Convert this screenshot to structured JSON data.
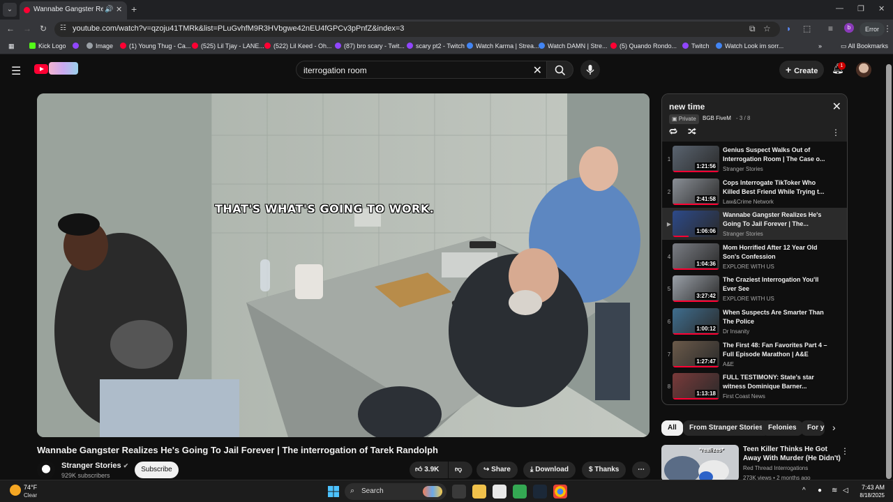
{
  "browser": {
    "tab": {
      "title": "Wannabe Gangster Realizes",
      "audio_icon": "speaker-icon",
      "close": "✕"
    },
    "new_tab": "+",
    "url": "youtube.com/watch?v=qzoju41TMRk&list=PLuGvhfM9R3HVbgwe42nEU4fGPCv3pPnfZ&index=3",
    "profile_status": "Error",
    "bookmarks": [
      {
        "label": "Kick Logo",
        "color": "#53fc18"
      },
      {
        "label": "Image",
        "color": "#9aa0a6"
      },
      {
        "label": "(1) Young Thug - Ca...",
        "color": "#ff0033"
      },
      {
        "label": "(525) Lil Tjay - LANE...",
        "color": "#ff0033"
      },
      {
        "label": "(522) Lil Keed - Oh...",
        "color": "#ff0033"
      },
      {
        "label": "(87) bro scary - Twit...",
        "color": "#9146ff"
      },
      {
        "label": "scary pt2 - Twitch",
        "color": "#9146ff"
      },
      {
        "label": "Watch Karma | Strea...",
        "color": "#4285f4"
      },
      {
        "label": "Watch DAMN | Stre...",
        "color": "#4285f4"
      },
      {
        "label": "(5) Quando Rondo...",
        "color": "#ff0033"
      },
      {
        "label": "Twitch",
        "color": "#9146ff"
      },
      {
        "label": "Watch Look im sorr...",
        "color": "#4285f4"
      }
    ],
    "all_bookmarks": "All Bookmarks"
  },
  "youtube": {
    "search_query": "iterrogation room",
    "create_label": "Create",
    "notification_count": "1"
  },
  "video": {
    "caption": "THAT'S WHAT'S GOING TO WORK.",
    "title": "Wannabe Gangster Realizes He's Going To Jail Forever | The interrogation of Tarek Randolph",
    "channel": "Stranger Stories",
    "subscribers": "929K subscribers",
    "subscribe_label": "Subscribe",
    "likes": "3.9K",
    "share_label": "Share",
    "download_label": "Download",
    "thanks_label": "Thanks"
  },
  "playlist": {
    "title": "new time",
    "privacy": "Private",
    "owner": "BGB FiveM",
    "position": "- 3 / 8",
    "items": [
      {
        "index": "1",
        "title": "Genius Suspect Walks Out of Interrogation Room | The Case o...",
        "channel": "Stranger Stories",
        "duration": "1:21:56",
        "progress": 1.0,
        "thumb": "#5a6470"
      },
      {
        "index": "2",
        "title": "Cops Interrogate TikToker Who Killed Best Friend While Trying t...",
        "channel": "Law&Crime Network",
        "duration": "2:41:58",
        "progress": 1.0,
        "thumb": "#8a8f96"
      },
      {
        "index": "▶",
        "title": "Wannabe Gangster Realizes He's Going To Jail Forever | The...",
        "channel": "Stranger Stories",
        "duration": "1:06:06",
        "progress": 0.35,
        "thumb": "#2d4a8a"
      },
      {
        "index": "4",
        "title": "Mom Horrified After 12 Year Old Son's Confession",
        "channel": "EXPLORE WITH US",
        "duration": "1:04:36",
        "progress": 1.0,
        "thumb": "#7a7d84"
      },
      {
        "index": "5",
        "title": "The Craziest Interrogation You'll Ever See",
        "channel": "EXPLORE WITH US",
        "duration": "3:27:42",
        "progress": 1.0,
        "thumb": "#9aa0a8"
      },
      {
        "index": "6",
        "title": "When Suspects Are Smarter Than The Police",
        "channel": "Dr Insanity",
        "duration": "1:00:12",
        "progress": 1.0,
        "thumb": "#3f6e8f"
      },
      {
        "index": "7",
        "title": "The First 48: Fan Favorites Part 4 – Full Episode Marathon | A&E",
        "channel": "A&E",
        "duration": "1:27:47",
        "progress": 1.0,
        "thumb": "#6b5a4a"
      },
      {
        "index": "8",
        "title": "FULL TESTIMONY: State's star witness Dominique Barner...",
        "channel": "First Coast News",
        "duration": "1:13:18",
        "progress": 1.0,
        "thumb": "#7a3a3a"
      }
    ]
  },
  "chips": [
    "All",
    "From Stranger Stories",
    "Felonies",
    "For y"
  ],
  "recommendation": {
    "title": "Teen Killer Thinks He Got Away With Murder (He Didn't)",
    "channel": "Red Thread Interrogations",
    "meta": "273K views • 2 months ago",
    "thumb_text": "*realizes*"
  },
  "taskbar": {
    "weather_temp": "74°F",
    "weather_cond": "Clear",
    "search_label": "Search",
    "time": "7:43 AM",
    "date": "8/18/2025"
  }
}
